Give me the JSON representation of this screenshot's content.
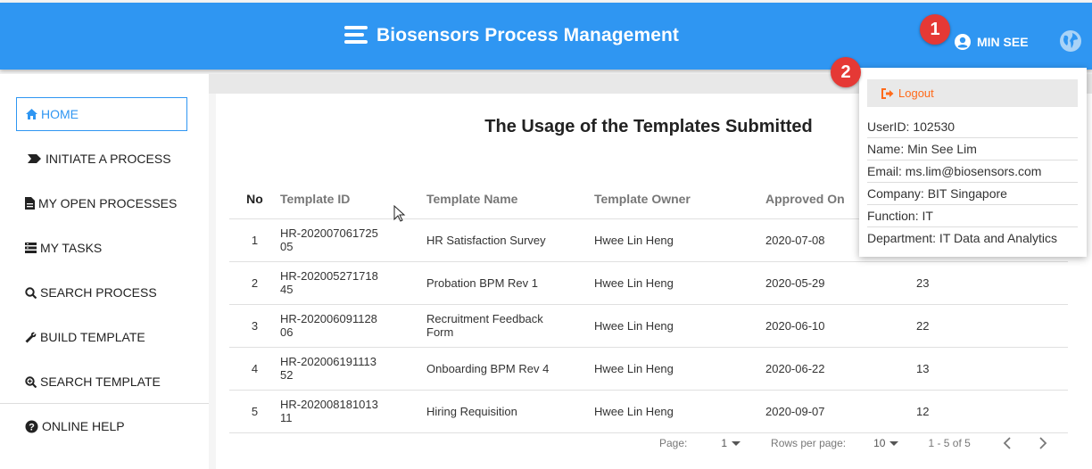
{
  "header": {
    "title": "Biosensors Process Management",
    "user_name": "MIN SEE",
    "brand_icon": "stacked-bars-icon",
    "user_icon": "account-circle-icon",
    "globe_icon": "globe-icon"
  },
  "markers": [
    "1",
    "2"
  ],
  "sidebar": {
    "items": [
      {
        "label": "HOME",
        "icon": "home-icon"
      },
      {
        "label": "INITIATE A PROCESS",
        "icon": "arrow-icon"
      },
      {
        "label": "MY OPEN PROCESSES",
        "icon": "document-icon"
      },
      {
        "label": "MY TASKS",
        "icon": "tasks-icon"
      },
      {
        "label": "SEARCH PROCESS",
        "icon": "search-icon"
      },
      {
        "label": "BUILD TEMPLATE",
        "icon": "wrench-icon"
      },
      {
        "label": "SEARCH TEMPLATE",
        "icon": "search-plus-icon"
      },
      {
        "label": "ONLINE HELP",
        "icon": "help-icon"
      }
    ]
  },
  "main": {
    "title": "The Usage of the Templates Submitted",
    "columns": [
      "No",
      "Template ID",
      "Template Name",
      "Template Owner",
      "Approved On"
    ],
    "rows": [
      {
        "no": "1",
        "id": "HR-20200706172505",
        "name": "HR Satisfaction Survey",
        "owner": "Hwee Lin Heng",
        "date": "2020-07-08",
        "count": ""
      },
      {
        "no": "2",
        "id": "HR-20200527171845",
        "name": "Probation BPM Rev 1",
        "owner": "Hwee Lin Heng",
        "date": "2020-05-29",
        "count": "23"
      },
      {
        "no": "3",
        "id": "HR-20200609112806",
        "name": "Recruitment Feedback Form",
        "owner": "Hwee Lin Heng",
        "date": "2020-06-10",
        "count": "22"
      },
      {
        "no": "4",
        "id": "HR-20200619111352",
        "name": "Onboarding BPM Rev 4",
        "owner": "Hwee Lin Heng",
        "date": "2020-06-22",
        "count": "13"
      },
      {
        "no": "5",
        "id": "HR-20200818101311",
        "name": "Hiring Requisition",
        "owner": "Hwee Lin Heng",
        "date": "2020-09-07",
        "count": "12"
      }
    ],
    "pagination": {
      "page_label": "Page:",
      "page_value": "1",
      "rows_label": "Rows per page:",
      "rows_value": "10",
      "range": "1 - 5 of 5"
    }
  },
  "dropdown": {
    "logout_label": "Logout",
    "logout_icon": "sign-out-icon",
    "info": [
      "UserID: 102530",
      "Name: Min See Lim",
      "Email: ms.lim@biosensors.com",
      "Company: BIT Singapore",
      "Function: IT",
      "Department: IT Data and Analytics"
    ]
  },
  "colors": {
    "header": "#2f96f2",
    "accent": "#2f96f2",
    "logout": "#ff6a1a",
    "marker": "#e53935"
  }
}
